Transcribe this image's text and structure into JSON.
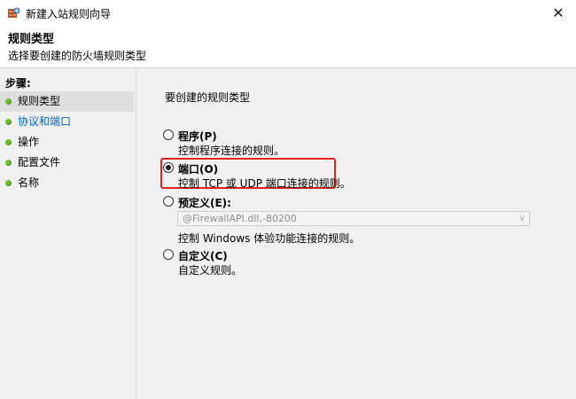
{
  "window": {
    "title": "新建入站规则向导",
    "close_glyph": "✕"
  },
  "header": {
    "title": "规则类型",
    "subtitle": "选择要创建的防火墙规则类型"
  },
  "sidebar": {
    "heading": "步骤:",
    "steps": [
      {
        "label": "规则类型",
        "state": "current"
      },
      {
        "label": "协议和端口",
        "state": "link"
      },
      {
        "label": "操作",
        "state": "normal"
      },
      {
        "label": "配置文件",
        "state": "normal"
      },
      {
        "label": "名称",
        "state": "normal"
      }
    ],
    "dot_color": "#6bbf2f"
  },
  "content": {
    "question": "要创建的规则类型",
    "options": {
      "program": {
        "label": "程序(P)",
        "desc": "控制程序连接的规则。",
        "checked": false
      },
      "port": {
        "label": "端口(O)",
        "desc": "控制 TCP 或 UDP 端口连接的规则。",
        "checked": true
      },
      "predefined": {
        "label": "预定义(E):",
        "combo_value": "@FirewallAPI.dll,-80200",
        "desc": "控制 Windows 体验功能连接的规则。",
        "checked": false
      },
      "custom": {
        "label": "自定义(C)",
        "desc": "自定义规则。",
        "checked": false
      }
    },
    "highlight_color": "#e0201a"
  }
}
